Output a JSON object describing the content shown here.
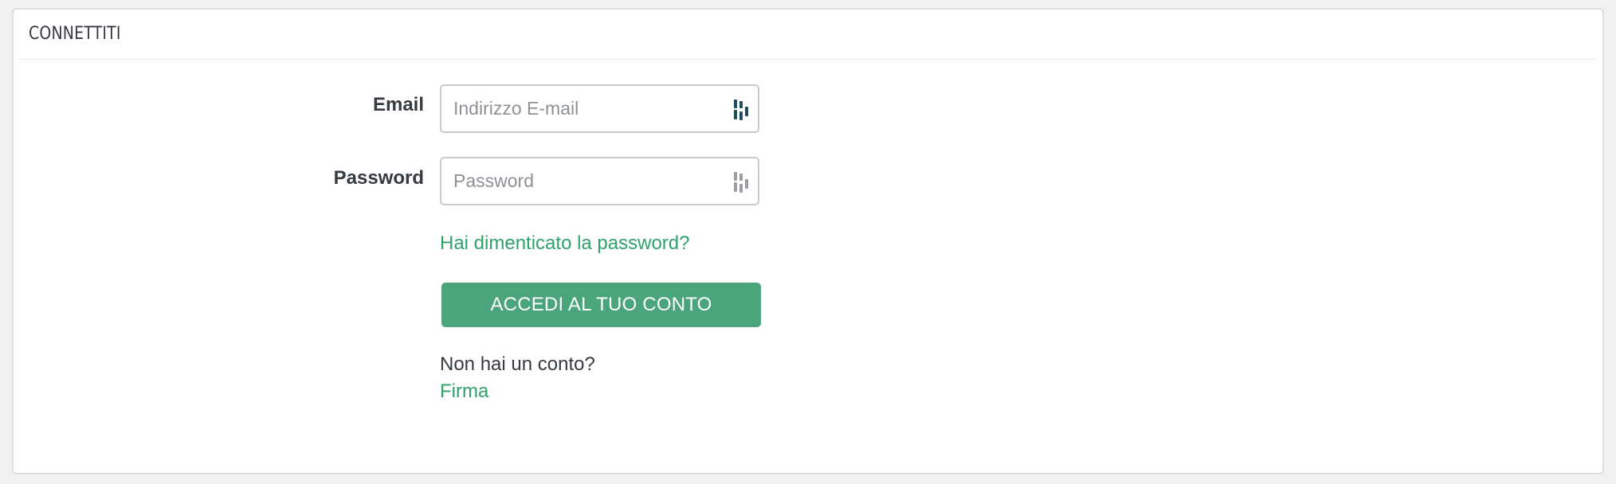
{
  "panel": {
    "title": "CONNETTITI"
  },
  "form": {
    "email": {
      "label": "Email",
      "placeholder": "Indirizzo E-mail",
      "value": ""
    },
    "password": {
      "label": "Password",
      "placeholder": "Password",
      "value": ""
    },
    "forgot_link": "Hai dimenticato la password?",
    "submit_label": "ACCEDI AL TUO CONTO",
    "no_account_text": "Non hai un conto?",
    "signup_link": "Firma"
  },
  "icons": {
    "email_field_icon": "password-manager-icon",
    "password_field_icon": "password-manager-icon"
  },
  "colors": {
    "accent": "#4aa67a",
    "link": "#2fa26b",
    "text": "#363a41",
    "icon_active": "#1f4e5a",
    "icon_inactive": "#9a9ea2"
  }
}
